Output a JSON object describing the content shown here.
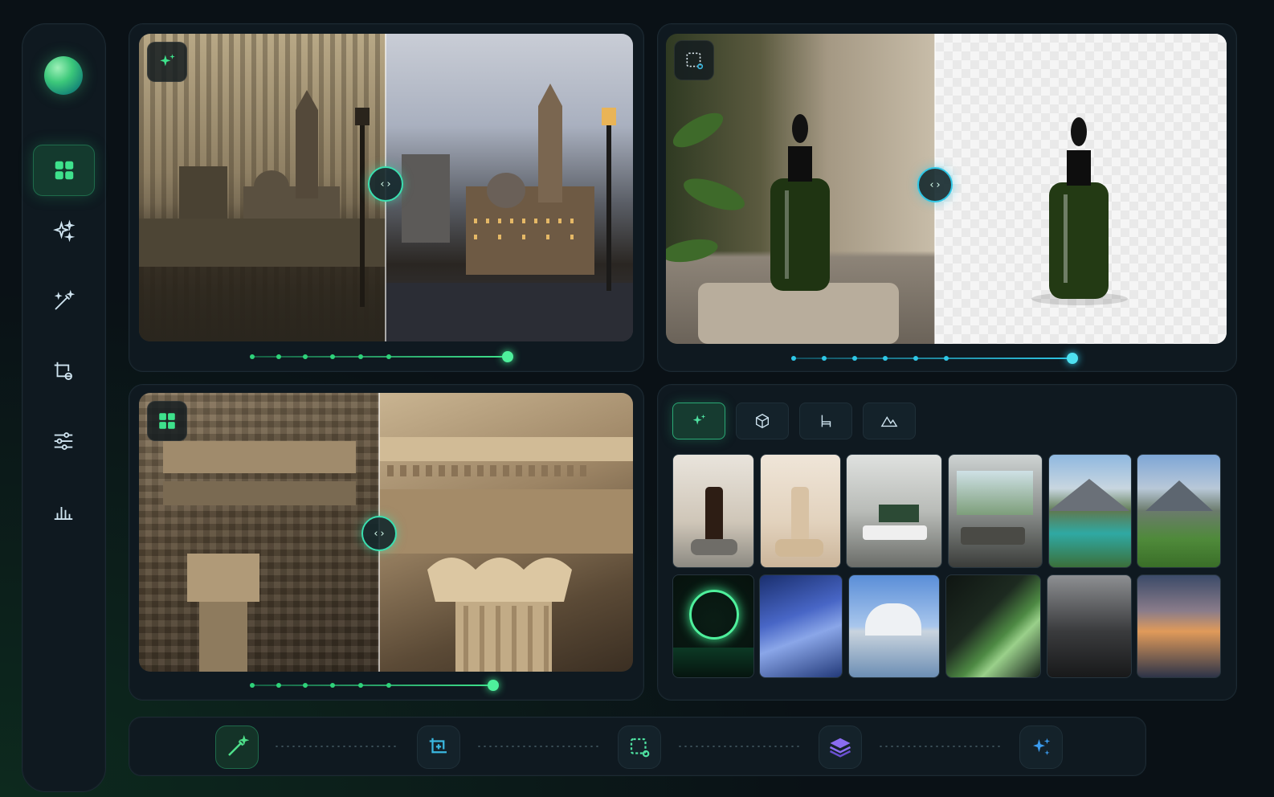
{
  "sidebar": {
    "logo": "gradient-orb-logo",
    "items": [
      {
        "icon": "dashboard-grid-icon",
        "active": true
      },
      {
        "icon": "sparkles-icon",
        "active": false
      },
      {
        "icon": "magic-wand-icon",
        "active": false
      },
      {
        "icon": "crop-icon",
        "active": false
      },
      {
        "icon": "sliders-icon",
        "active": false
      },
      {
        "icon": "bar-chart-icon",
        "active": false
      }
    ]
  },
  "panels": {
    "restore": {
      "badge_icon": "sparkles-icon",
      "slider_value": 1.0,
      "compare": "old-photo-vs-restored-city"
    },
    "background_removal": {
      "badge_icon": "selection-icon",
      "slider_value": 1.0,
      "compare": "bottle-vs-transparent-background"
    },
    "upscale": {
      "badge_icon": "dashboard-grid-icon",
      "slider_value": 1.0,
      "compare": "pixelated-vs-sharp-architecture"
    }
  },
  "gallery": {
    "tabs": [
      {
        "icon": "sparkles-icon",
        "active": true
      },
      {
        "icon": "cube-icon",
        "active": false
      },
      {
        "icon": "chair-icon",
        "active": false
      },
      {
        "icon": "mountain-icon",
        "active": false
      }
    ]
  },
  "toolbar": {
    "tools": [
      {
        "icon": "magic-wand-icon",
        "color": "#4ee08a"
      },
      {
        "icon": "crop-plus-icon",
        "color": "#3ab8e0"
      },
      {
        "icon": "selection-icon",
        "color": "#4ee0a0"
      },
      {
        "icon": "layers-icon",
        "color": "#8a6cf0"
      },
      {
        "icon": "sparkles-icon",
        "color": "#3a9cf0"
      }
    ]
  },
  "colors": {
    "accent": "#3ae0b0",
    "green": "#2fd27a",
    "cyan": "#2ec7e6",
    "bg": "#0a1116",
    "panel": "#0f1920"
  }
}
